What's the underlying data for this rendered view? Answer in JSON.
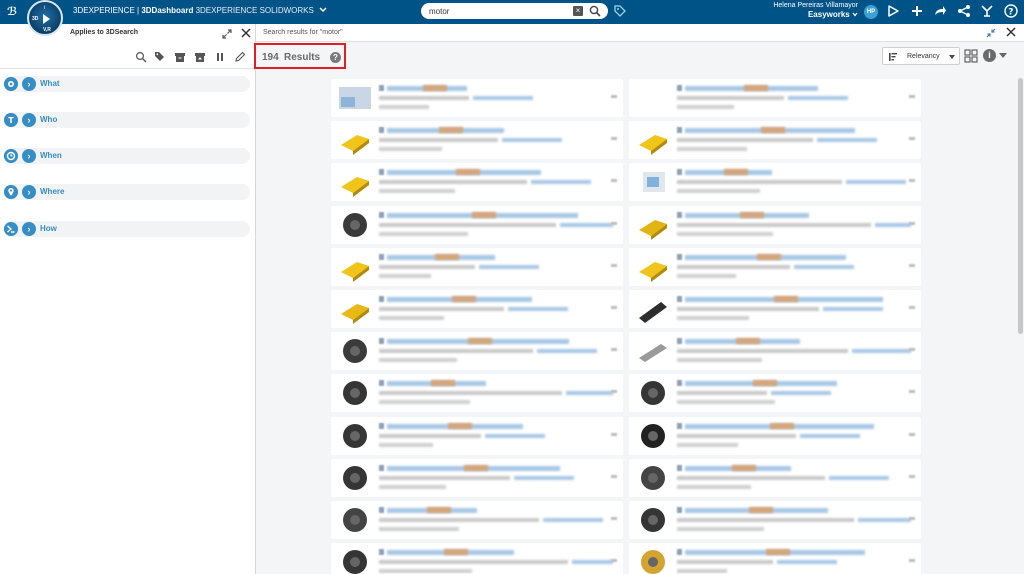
{
  "topbar": {
    "brand_part1": "3DEXPERIENCE | ",
    "brand_part2": "3DDashboard",
    "brand_part3": " 3DEXPERIENCE SOLIDWORKS",
    "compass_3d": "3D",
    "compass_v": "V,R",
    "compass_i": "i",
    "search_value": "motor",
    "search_placeholder": "Search",
    "user_name": "Helena Pereiras Villamayor",
    "tenant": "Easyworks",
    "avatar_initials": "HP",
    "accent_color": "#005386"
  },
  "left_panel": {
    "title": "Applies to 3DSearch",
    "facets": [
      {
        "label": "What",
        "icon": "what-icon"
      },
      {
        "label": "Who",
        "icon": "who-icon"
      },
      {
        "label": "When",
        "icon": "when-icon"
      },
      {
        "label": "Where",
        "icon": "where-icon"
      },
      {
        "label": "How",
        "icon": "how-icon"
      }
    ]
  },
  "main": {
    "search_title": "Search results for \"motor\"",
    "results_count": "194",
    "results_label": "Results",
    "help": "?",
    "info": "i",
    "sort_label": "Relevancy",
    "highlight_color": "#e02020"
  }
}
